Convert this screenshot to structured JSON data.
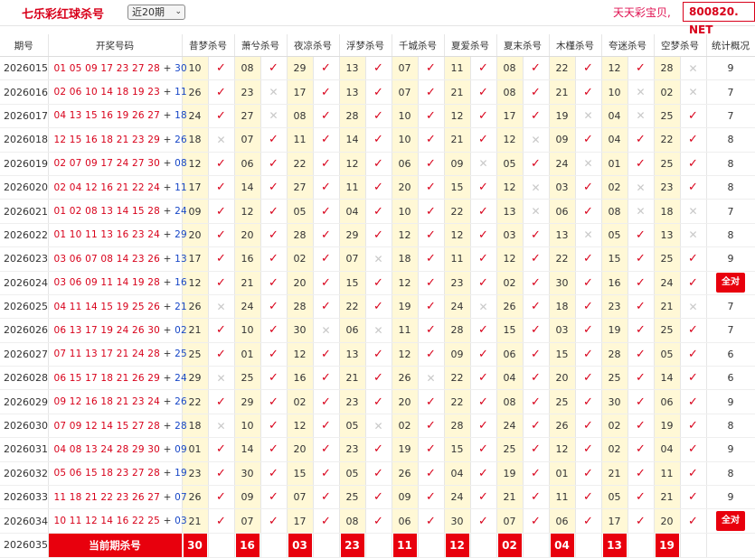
{
  "header": {
    "title": "七乐彩红球杀号",
    "select": {
      "value": "近20期",
      "options": [
        "近20期"
      ]
    },
    "brand_text": "天天彩宝贝,",
    "brand_url": "800820. NET"
  },
  "table": {
    "columns": [
      "期号",
      "开奖号码",
      "昔梦杀号",
      "萧兮杀号",
      "夜凉杀号",
      "浮梦杀号",
      "千城杀号",
      "夏爱杀号",
      "夏末杀号",
      "木槿杀号",
      "夸迷杀号",
      "空梦杀号",
      "统计概况"
    ],
    "rows": [
      {
        "issue": "2026015",
        "nums": "01 05 09 17 23 27 28",
        "special": "30",
        "kills": [
          [
            "10",
            true
          ],
          [
            "08",
            true
          ],
          [
            "29",
            true
          ],
          [
            "13",
            true
          ],
          [
            "07",
            true
          ],
          [
            "11",
            true
          ],
          [
            "08",
            true
          ],
          [
            "22",
            true
          ],
          [
            "12",
            true
          ],
          [
            "28",
            false
          ]
        ],
        "stat": "9"
      },
      {
        "issue": "2026016",
        "nums": "02 06 10 14 18 19 23",
        "special": "11",
        "kills": [
          [
            "26",
            true
          ],
          [
            "23",
            false
          ],
          [
            "17",
            true
          ],
          [
            "13",
            true
          ],
          [
            "07",
            true
          ],
          [
            "21",
            true
          ],
          [
            "08",
            true
          ],
          [
            "21",
            true
          ],
          [
            "10",
            false
          ],
          [
            "02",
            false
          ]
        ],
        "stat": "7"
      },
      {
        "issue": "2026017",
        "nums": "04 13 15 16 19 26 27",
        "special": "18",
        "kills": [
          [
            "24",
            true
          ],
          [
            "27",
            false
          ],
          [
            "08",
            true
          ],
          [
            "28",
            true
          ],
          [
            "10",
            true
          ],
          [
            "12",
            true
          ],
          [
            "17",
            true
          ],
          [
            "19",
            false
          ],
          [
            "04",
            false
          ],
          [
            "25",
            true
          ]
        ],
        "stat": "7"
      },
      {
        "issue": "2026018",
        "nums": "12 15 16 18 21 23 29",
        "special": "26",
        "kills": [
          [
            "18",
            false
          ],
          [
            "07",
            true
          ],
          [
            "11",
            true
          ],
          [
            "14",
            true
          ],
          [
            "10",
            true
          ],
          [
            "21",
            true
          ],
          [
            "12",
            false
          ],
          [
            "09",
            true
          ],
          [
            "04",
            true
          ],
          [
            "22",
            true
          ]
        ],
        "stat": "8"
      },
      {
        "issue": "2026019",
        "nums": "02 07 09 17 24 27 30",
        "special": "08",
        "kills": [
          [
            "12",
            true
          ],
          [
            "06",
            true
          ],
          [
            "22",
            true
          ],
          [
            "12",
            true
          ],
          [
            "06",
            true
          ],
          [
            "09",
            false
          ],
          [
            "05",
            true
          ],
          [
            "24",
            false
          ],
          [
            "01",
            true
          ],
          [
            "25",
            true
          ]
        ],
        "stat": "8"
      },
      {
        "issue": "2026020",
        "nums": "02 04 12 16 21 22 24",
        "special": "11",
        "kills": [
          [
            "17",
            true
          ],
          [
            "14",
            true
          ],
          [
            "27",
            true
          ],
          [
            "11",
            true
          ],
          [
            "20",
            true
          ],
          [
            "15",
            true
          ],
          [
            "12",
            false
          ],
          [
            "03",
            true
          ],
          [
            "02",
            false
          ],
          [
            "23",
            true
          ]
        ],
        "stat": "8"
      },
      {
        "issue": "2026021",
        "nums": "01 02 08 13 14 15 28",
        "special": "24",
        "kills": [
          [
            "09",
            true
          ],
          [
            "12",
            true
          ],
          [
            "05",
            true
          ],
          [
            "04",
            true
          ],
          [
            "10",
            true
          ],
          [
            "22",
            true
          ],
          [
            "13",
            false
          ],
          [
            "06",
            true
          ],
          [
            "08",
            false
          ],
          [
            "18",
            false
          ]
        ],
        "stat": "7"
      },
      {
        "issue": "2026022",
        "nums": "01 10 11 13 16 23 24",
        "special": "29",
        "kills": [
          [
            "20",
            true
          ],
          [
            "20",
            true
          ],
          [
            "28",
            true
          ],
          [
            "29",
            true
          ],
          [
            "12",
            true
          ],
          [
            "12",
            true
          ],
          [
            "03",
            true
          ],
          [
            "13",
            false
          ],
          [
            "05",
            true
          ],
          [
            "13",
            false
          ]
        ],
        "stat": "8"
      },
      {
        "issue": "2026023",
        "nums": "03 06 07 08 14 23 26",
        "special": "13",
        "kills": [
          [
            "17",
            true
          ],
          [
            "16",
            true
          ],
          [
            "02",
            true
          ],
          [
            "07",
            false
          ],
          [
            "18",
            true
          ],
          [
            "11",
            true
          ],
          [
            "12",
            true
          ],
          [
            "22",
            true
          ],
          [
            "15",
            true
          ],
          [
            "25",
            true
          ]
        ],
        "stat": "9"
      },
      {
        "issue": "2026024",
        "nums": "03 06 09 11 14 19 28",
        "special": "16",
        "kills": [
          [
            "12",
            true
          ],
          [
            "21",
            true
          ],
          [
            "20",
            true
          ],
          [
            "15",
            true
          ],
          [
            "12",
            true
          ],
          [
            "23",
            true
          ],
          [
            "02",
            true
          ],
          [
            "30",
            true
          ],
          [
            "16",
            true
          ],
          [
            "24",
            true
          ]
        ],
        "stat": "全对"
      },
      {
        "issue": "2026025",
        "nums": "04 11 14 15 19 25 26",
        "special": "21",
        "kills": [
          [
            "26",
            false
          ],
          [
            "24",
            true
          ],
          [
            "28",
            true
          ],
          [
            "22",
            true
          ],
          [
            "19",
            true
          ],
          [
            "24",
            false
          ],
          [
            "26",
            true
          ],
          [
            "18",
            true
          ],
          [
            "23",
            true
          ],
          [
            "21",
            false
          ]
        ],
        "stat": "7"
      },
      {
        "issue": "2026026",
        "nums": "06 13 17 19 24 26 30",
        "special": "02",
        "kills": [
          [
            "21",
            true
          ],
          [
            "10",
            true
          ],
          [
            "30",
            false
          ],
          [
            "06",
            false
          ],
          [
            "11",
            true
          ],
          [
            "28",
            true
          ],
          [
            "15",
            true
          ],
          [
            "03",
            true
          ],
          [
            "19",
            true
          ],
          [
            "25",
            true
          ]
        ],
        "stat": "7"
      },
      {
        "issue": "2026027",
        "nums": "07 11 13 17 21 24 28",
        "special": "25",
        "kills": [
          [
            "25",
            true
          ],
          [
            "01",
            true
          ],
          [
            "12",
            true
          ],
          [
            "13",
            true
          ],
          [
            "12",
            true
          ],
          [
            "09",
            true
          ],
          [
            "06",
            true
          ],
          [
            "15",
            true
          ],
          [
            "28",
            true
          ],
          [
            "05",
            true
          ]
        ],
        "stat": "6"
      },
      {
        "issue": "2026028",
        "nums": "06 15 17 18 21 26 29",
        "special": "24",
        "kills": [
          [
            "29",
            false
          ],
          [
            "25",
            true
          ],
          [
            "16",
            true
          ],
          [
            "21",
            true
          ],
          [
            "26",
            false
          ],
          [
            "22",
            true
          ],
          [
            "04",
            true
          ],
          [
            "20",
            true
          ],
          [
            "25",
            true
          ],
          [
            "14",
            true
          ]
        ],
        "stat": "6"
      },
      {
        "issue": "2026029",
        "nums": "09 12 16 18 21 23 24",
        "special": "26",
        "kills": [
          [
            "22",
            true
          ],
          [
            "29",
            true
          ],
          [
            "02",
            true
          ],
          [
            "23",
            true
          ],
          [
            "20",
            true
          ],
          [
            "22",
            true
          ],
          [
            "08",
            true
          ],
          [
            "25",
            true
          ],
          [
            "30",
            true
          ],
          [
            "06",
            true
          ]
        ],
        "stat": "9"
      },
      {
        "issue": "2026030",
        "nums": "07 09 12 14 15 27 28",
        "special": "28",
        "kills": [
          [
            "18",
            false
          ],
          [
            "10",
            true
          ],
          [
            "12",
            true
          ],
          [
            "05",
            false
          ],
          [
            "02",
            true
          ],
          [
            "28",
            true
          ],
          [
            "24",
            true
          ],
          [
            "26",
            true
          ],
          [
            "02",
            true
          ],
          [
            "19",
            true
          ]
        ],
        "stat": "8"
      },
      {
        "issue": "2026031",
        "nums": "04 08 13 24 28 29 30",
        "special": "09",
        "kills": [
          [
            "01",
            true
          ],
          [
            "14",
            true
          ],
          [
            "20",
            true
          ],
          [
            "23",
            true
          ],
          [
            "19",
            true
          ],
          [
            "15",
            true
          ],
          [
            "25",
            true
          ],
          [
            "12",
            true
          ],
          [
            "02",
            true
          ],
          [
            "04",
            true
          ]
        ],
        "stat": "9"
      },
      {
        "issue": "2026032",
        "nums": "05 06 15 18 23 27 28",
        "special": "19",
        "kills": [
          [
            "23",
            true
          ],
          [
            "30",
            true
          ],
          [
            "15",
            true
          ],
          [
            "05",
            true
          ],
          [
            "26",
            true
          ],
          [
            "04",
            true
          ],
          [
            "19",
            true
          ],
          [
            "01",
            true
          ],
          [
            "21",
            true
          ],
          [
            "11",
            true
          ]
        ],
        "stat": "8"
      },
      {
        "issue": "2026033",
        "nums": "11 18 21 22 23 26 27",
        "special": "07",
        "kills": [
          [
            "26",
            true
          ],
          [
            "09",
            true
          ],
          [
            "07",
            true
          ],
          [
            "25",
            true
          ],
          [
            "09",
            true
          ],
          [
            "24",
            true
          ],
          [
            "21",
            true
          ],
          [
            "11",
            true
          ],
          [
            "05",
            true
          ],
          [
            "21",
            true
          ]
        ],
        "stat": "9"
      },
      {
        "issue": "2026034",
        "nums": "10 11 12 14 16 22 25",
        "special": "03",
        "kills": [
          [
            "21",
            true
          ],
          [
            "07",
            true
          ],
          [
            "17",
            true
          ],
          [
            "08",
            true
          ],
          [
            "06",
            true
          ],
          [
            "30",
            true
          ],
          [
            "07",
            true
          ],
          [
            "06",
            true
          ],
          [
            "17",
            true
          ],
          [
            "20",
            true
          ]
        ],
        "stat": "全对"
      }
    ],
    "current": {
      "issue": "2026035",
      "label": "当前期杀号",
      "values": [
        "30",
        "16",
        "03",
        "23",
        "11",
        "12",
        "02",
        "04",
        "13",
        "19"
      ]
    }
  },
  "colors": {
    "accent_red": "#e8000d",
    "special_blue": "#1646c7",
    "highlight_yellow": "#fff8d6"
  }
}
